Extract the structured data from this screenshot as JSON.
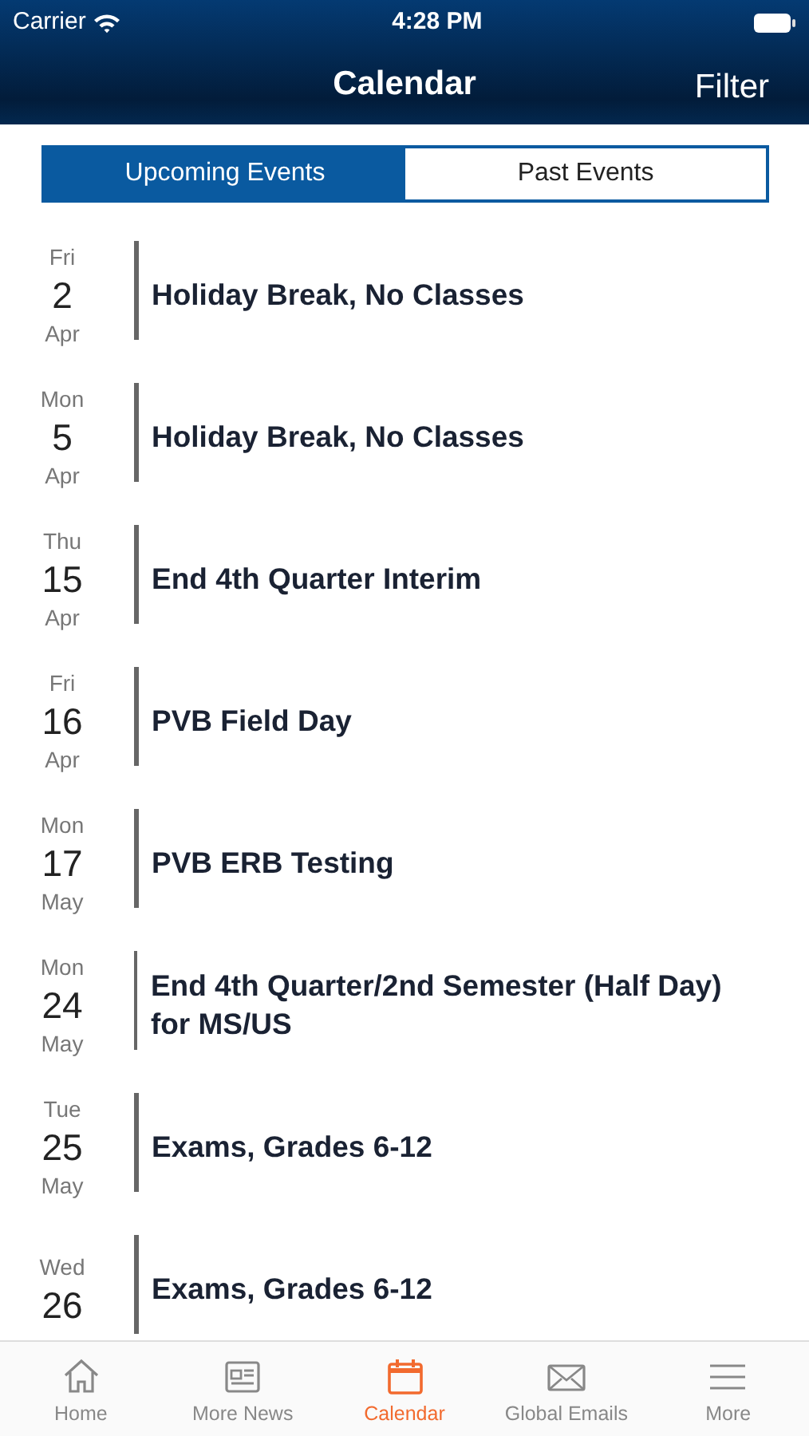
{
  "status_bar": {
    "carrier": "Carrier",
    "time": "4:28 PM"
  },
  "nav": {
    "title": "Calendar",
    "action": "Filter"
  },
  "segments": [
    {
      "label": "Upcoming Events",
      "selected": true
    },
    {
      "label": "Past Events",
      "selected": false
    }
  ],
  "events": [
    {
      "weekday": "Fri",
      "day": "2",
      "month": "Apr",
      "title": "Holiday Break, No Classes"
    },
    {
      "weekday": "Mon",
      "day": "5",
      "month": "Apr",
      "title": "Holiday Break, No Classes"
    },
    {
      "weekday": "Thu",
      "day": "15",
      "month": "Apr",
      "title": "End 4th Quarter Interim"
    },
    {
      "weekday": "Fri",
      "day": "16",
      "month": "Apr",
      "title": "PVB Field Day"
    },
    {
      "weekday": "Mon",
      "day": "17",
      "month": "May",
      "title": "PVB ERB Testing"
    },
    {
      "weekday": "Mon",
      "day": "24",
      "month": "May",
      "title": "End 4th Quarter/2nd Semester (Half Day) for MS/US"
    },
    {
      "weekday": "Tue",
      "day": "25",
      "month": "May",
      "title": "Exams, Grades 6-12"
    },
    {
      "weekday": "Wed",
      "day": "26",
      "title": "Exams, Grades 6-12"
    }
  ],
  "tab_bar": [
    {
      "label": "Home",
      "kind": "home",
      "selected": false
    },
    {
      "label": "More News",
      "kind": "news",
      "selected": false
    },
    {
      "label": "Calendar",
      "kind": "calendar",
      "selected": true
    },
    {
      "label": "Global Emails",
      "kind": "mail",
      "selected": false
    },
    {
      "label": "More",
      "kind": "menu",
      "selected": false
    }
  ]
}
